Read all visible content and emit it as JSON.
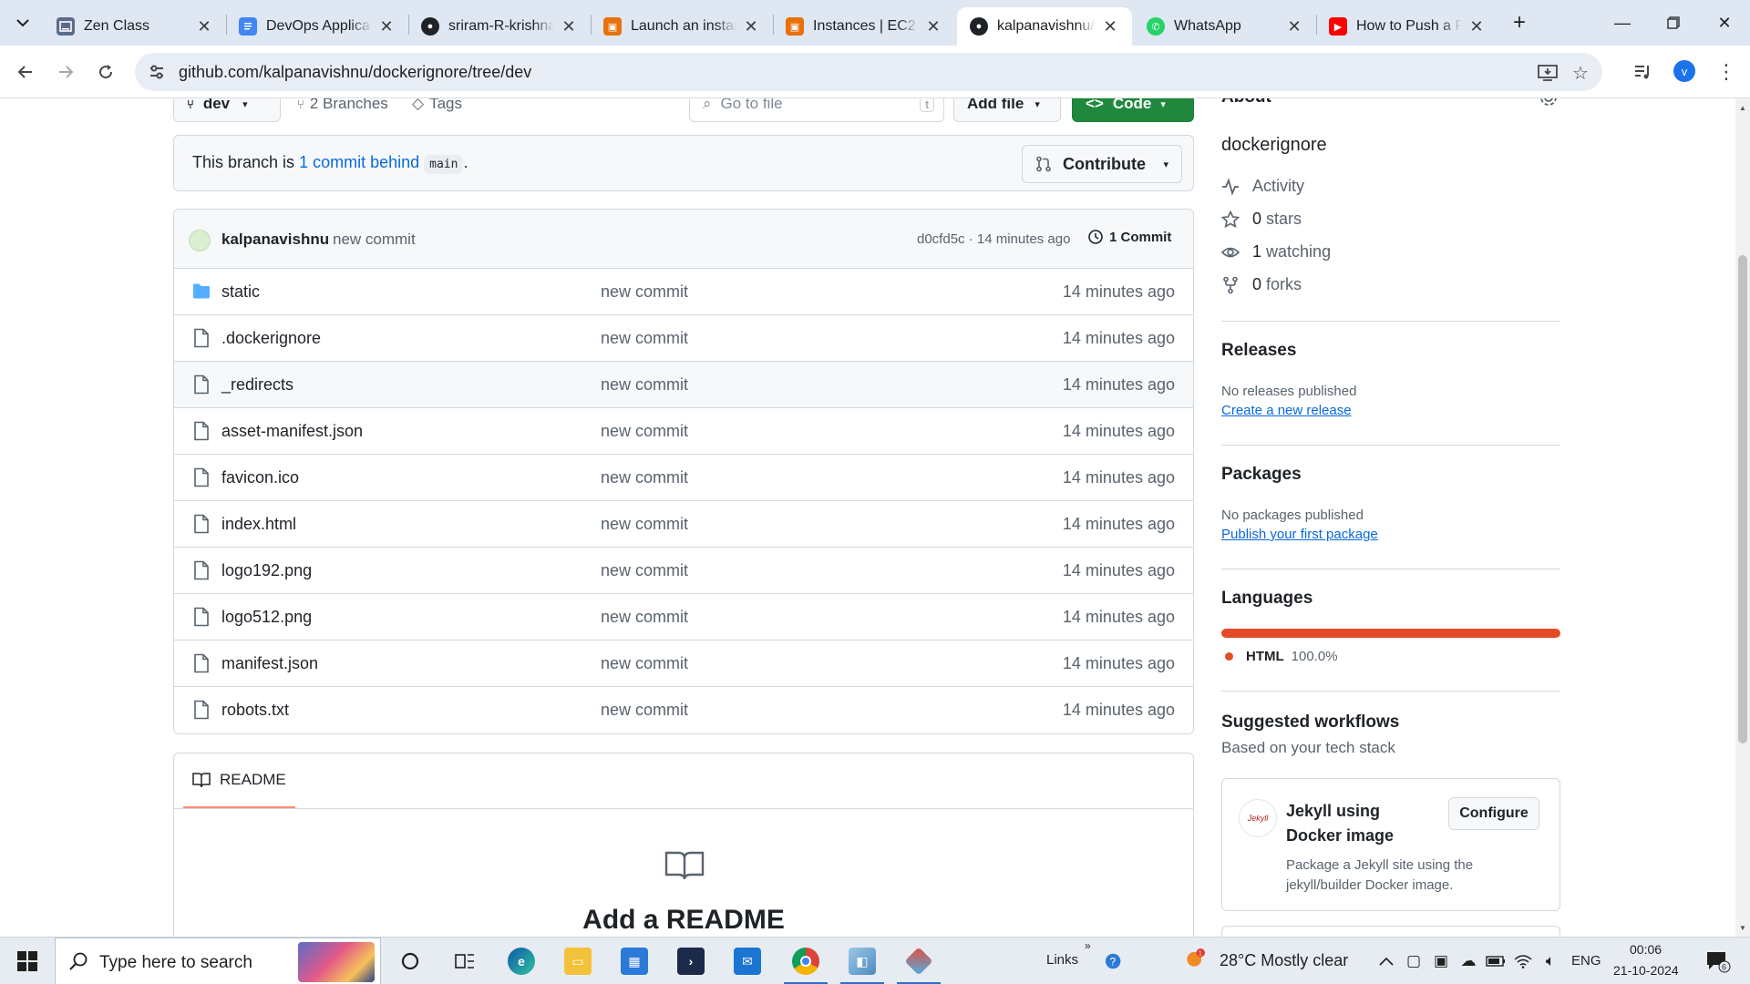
{
  "browser": {
    "tabs": [
      {
        "title": "Zen Class",
        "favicon": "zen-favicon",
        "color": "#5b6b8c"
      },
      {
        "title": "DevOps Application",
        "favicon": "docs-favicon",
        "color": "#4285f4"
      },
      {
        "title": "sriram-R-krishnan",
        "favicon": "github-favicon",
        "color": "#1f2328"
      },
      {
        "title": "Launch an instance",
        "favicon": "aws-favicon",
        "color": "#e8710a"
      },
      {
        "title": "Instances | EC2",
        "favicon": "aws-favicon",
        "color": "#e8710a"
      },
      {
        "title": "kalpanavishnu/dockerignore",
        "favicon": "github-favicon",
        "color": "#1f2328",
        "active": true
      },
      {
        "title": "WhatsApp",
        "favicon": "whatsapp-favicon",
        "color": "#25d366"
      },
      {
        "title": "How to Push a Project",
        "favicon": "youtube-favicon",
        "color": "#ff0000"
      }
    ],
    "url": "github.com/kalpanavishnu/dockerignore/tree/dev",
    "profile_initial": "v"
  },
  "repo": {
    "branch_label": "dev",
    "branches_label": "2 Branches",
    "tags_label": "Tags",
    "go_to_file_placeholder": "Go to file",
    "go_to_file_shortcut": "t",
    "add_file_label": "Add file",
    "code_label": "Code",
    "behind_prefix": "This branch is",
    "behind_link": "1 commit behind",
    "behind_branch": "main",
    "behind_suffix": ".",
    "contribute_label": "Contribute",
    "commit_author": "kalpanavishnu",
    "commit_message": "new commit",
    "commit_meta": "d0cfd5c · 14 minutes ago",
    "commit_count": "1 Commit",
    "files": [
      {
        "name": "static",
        "type": "folder",
        "message": "new commit",
        "time": "14 minutes ago"
      },
      {
        "name": ".dockerignore",
        "type": "file",
        "message": "new commit",
        "time": "14 minutes ago"
      },
      {
        "name": "_redirects",
        "type": "file",
        "message": "new commit",
        "time": "14 minutes ago"
      },
      {
        "name": "asset-manifest.json",
        "type": "file",
        "message": "new commit",
        "time": "14 minutes ago"
      },
      {
        "name": "favicon.ico",
        "type": "file",
        "message": "new commit",
        "time": "14 minutes ago"
      },
      {
        "name": "index.html",
        "type": "file",
        "message": "new commit",
        "time": "14 minutes ago"
      },
      {
        "name": "logo192.png",
        "type": "file",
        "message": "new commit",
        "time": "14 minutes ago"
      },
      {
        "name": "logo512.png",
        "type": "file",
        "message": "new commit",
        "time": "14 minutes ago"
      },
      {
        "name": "manifest.json",
        "type": "file",
        "message": "new commit",
        "time": "14 minutes ago"
      },
      {
        "name": "robots.txt",
        "type": "file",
        "message": "new commit",
        "time": "14 minutes ago"
      }
    ],
    "readme_tab": "README",
    "readme_heading": "Add a README"
  },
  "sidebar": {
    "about_heading": "About",
    "description": "dockerignore",
    "activity": "Activity",
    "stars_count": "0",
    "stars_label": "stars",
    "watching_count": "1",
    "watching_label": "watching",
    "forks_count": "0",
    "forks_label": "forks",
    "releases_heading": "Releases",
    "releases_text": "No releases published",
    "releases_link": "Create a new release",
    "packages_heading": "Packages",
    "packages_text": "No packages published",
    "packages_link": "Publish your first package",
    "languages_heading": "Languages",
    "language_name": "HTML",
    "language_percent": "100.0%",
    "language_color": "#e34c26",
    "workflows_heading": "Suggested workflows",
    "workflows_sub": "Based on your tech stack",
    "workflow_logo_text": "Jekyll",
    "workflow_title": "Jekyll using Docker image",
    "workflow_button": "Configure",
    "workflow_desc": "Package a Jekyll site using the jekyll/builder Docker image."
  },
  "taskbar": {
    "search_placeholder": "Type here to search",
    "links_label": "Links",
    "weather": "28°C  Mostly clear",
    "weather_badge": "1",
    "lang": "ENG",
    "time": "00:06",
    "date": "21-10-2024",
    "notif_count": "6"
  }
}
